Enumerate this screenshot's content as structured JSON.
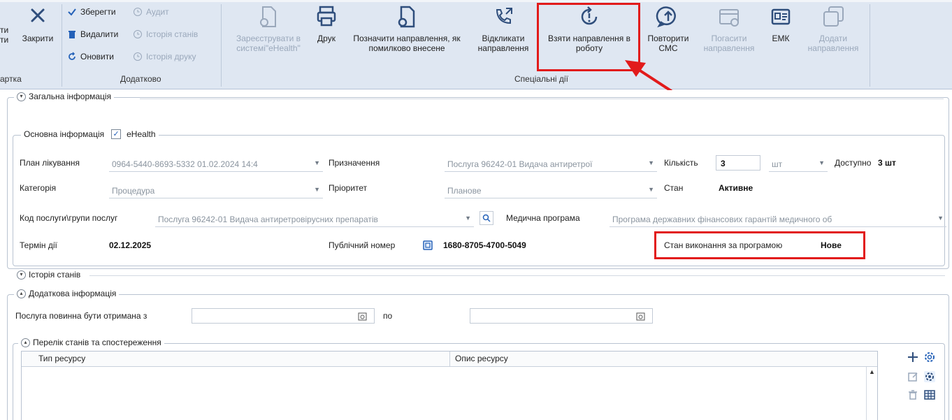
{
  "ribbon": {
    "card_group": {
      "label_partial_1": "ти",
      "label_partial_2": "ти",
      "group_label": "артка",
      "close_label": "Закрити"
    },
    "additional_group": {
      "save": "Зберегти",
      "audit": "Аудит",
      "delete": "Видалити",
      "state_history": "Історія станів",
      "refresh": "Оновити",
      "print_history": "Історія друку",
      "group_label": "Додатково"
    },
    "special_group": {
      "register_ehealth": "Зареєструвати в системі\"eHealth\"",
      "print": "Друк",
      "mark_erroneous": "Позначити направлення, як помилково внесене",
      "revoke_referral": "Відкликати направлення",
      "take_to_work": "Взяти направлення в роботу",
      "repeat_sms": "Повторити СМС",
      "repay_referral": "Погасити направлення",
      "emk": "ЕМК",
      "add_referral": "Додати направлення",
      "group_label": "Спеціальні дії"
    }
  },
  "general_info": {
    "title": "Загальна інформація",
    "basic_info_title": "Основна інформація",
    "ehealth_label": "eHealth",
    "ehealth_checked": true,
    "treatment_plan_label": "План лікування",
    "treatment_plan_value": "0964-5440-8693-5332 01.02.2024 14:4",
    "purpose_label": "Призначення",
    "purpose_value": "Послуга 96242-01 Видача антиретрої",
    "quantity_label": "Кількість",
    "quantity_value": "3",
    "unit_value": "шт",
    "available_label": "Доступно",
    "available_value": "3 шт",
    "category_label": "Категорія",
    "category_value": "Процедура",
    "priority_label": "Пріоритет",
    "priority_value": "Планове",
    "state_label": "Стан",
    "state_value": "Активне",
    "service_code_label": "Код послуги\\групи послуг",
    "service_code_value": "Послуга 96242-01 Видача антиретровірусних препаратів",
    "medical_program_label": "Медична програма",
    "medical_program_value": "Програма державних фінансових гарантій медичного об",
    "validity_label": "Термін дії",
    "validity_value": "02.12.2025",
    "public_number_label": "Публічний номер",
    "public_number_value": "1680-8705-4700-5049",
    "program_execution_label": "Стан виконання за програмою",
    "program_execution_value": "Нове"
  },
  "state_history": {
    "title": "Історія станів"
  },
  "additional_info": {
    "title": "Додаткова інформація",
    "service_from_label": "Послуга повинна бути отримана з",
    "to_label": "по",
    "states_title": "Перелік станів та спостереження",
    "columns": [
      "Тип ресурсу",
      "Опис ресурсу"
    ]
  },
  "colors": {
    "highlight": "#e21b1b",
    "accent": "#2461b8",
    "ribbon_bg": "#dfe7f2"
  },
  "icons": [
    "close-icon",
    "check-icon",
    "trash-icon",
    "refresh-icon",
    "clock-icon",
    "document-add-icon",
    "printer-icon",
    "document-mark-icon",
    "phone-revoke-icon",
    "sync-alert-icon",
    "chat-up-icon",
    "card-check-icon",
    "id-card-icon",
    "copy-icon",
    "calendar-icon",
    "search-icon",
    "plus-icon",
    "gear-icon",
    "edit-icon",
    "table-icon"
  ]
}
